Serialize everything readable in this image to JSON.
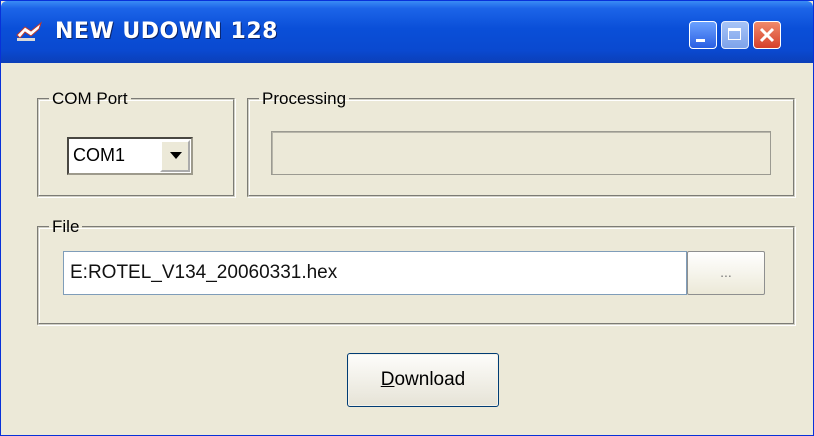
{
  "window": {
    "title": "NEW UDOWN 128",
    "icon": "app-icon",
    "controls": {
      "minimize": "minimize-icon",
      "maximize": "maximize-icon",
      "close": "close-icon"
    }
  },
  "com_port": {
    "label": "COM Port",
    "selected": "COM1"
  },
  "processing": {
    "label": "Processing",
    "progress": 0
  },
  "file": {
    "label": "File",
    "path": "E:ROTEL_V134_20060331.hex",
    "browse_label": "..."
  },
  "download": {
    "mnemonic": "D",
    "rest": "ownload"
  },
  "colors": {
    "titlebar": "#0a4fd8",
    "window_bg": "#ece9d8",
    "close_button": "#d6402b"
  }
}
